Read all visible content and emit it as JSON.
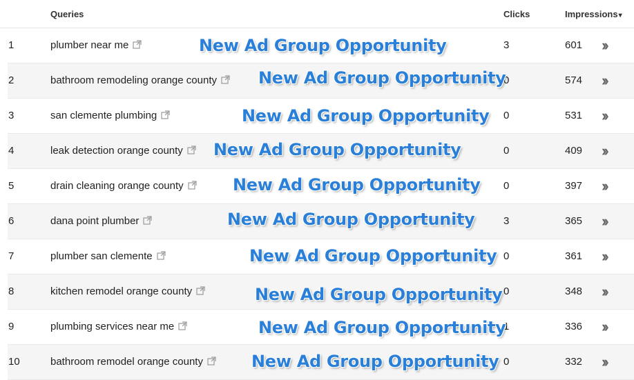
{
  "header": {
    "queries_label": "Queries",
    "clicks_label": "Clicks",
    "impressions_label": "Impressions",
    "sort_icon": "▾"
  },
  "annotation_text": "New Ad Group Opportunity",
  "accent_color": "#2a7fd9",
  "rows": [
    {
      "num": "1",
      "query": "plumber near me",
      "clicks": "3",
      "impressions": "601"
    },
    {
      "num": "2",
      "query": "bathroom remodeling orange county",
      "clicks": "0",
      "impressions": "574"
    },
    {
      "num": "3",
      "query": "san clemente plumbing",
      "clicks": "0",
      "impressions": "531"
    },
    {
      "num": "4",
      "query": "leak detection orange county",
      "clicks": "0",
      "impressions": "409"
    },
    {
      "num": "5",
      "query": "drain cleaning orange county",
      "clicks": "0",
      "impressions": "397"
    },
    {
      "num": "6",
      "query": "dana point plumber",
      "clicks": "3",
      "impressions": "365"
    },
    {
      "num": "7",
      "query": "plumber san clemente",
      "clicks": "0",
      "impressions": "361"
    },
    {
      "num": "8",
      "query": "kitchen remodel orange county",
      "clicks": "0",
      "impressions": "348"
    },
    {
      "num": "9",
      "query": "plumbing services near me",
      "clicks": "1",
      "impressions": "336"
    },
    {
      "num": "10",
      "query": "bathroom remodel orange county",
      "clicks": "0",
      "impressions": "332"
    }
  ]
}
